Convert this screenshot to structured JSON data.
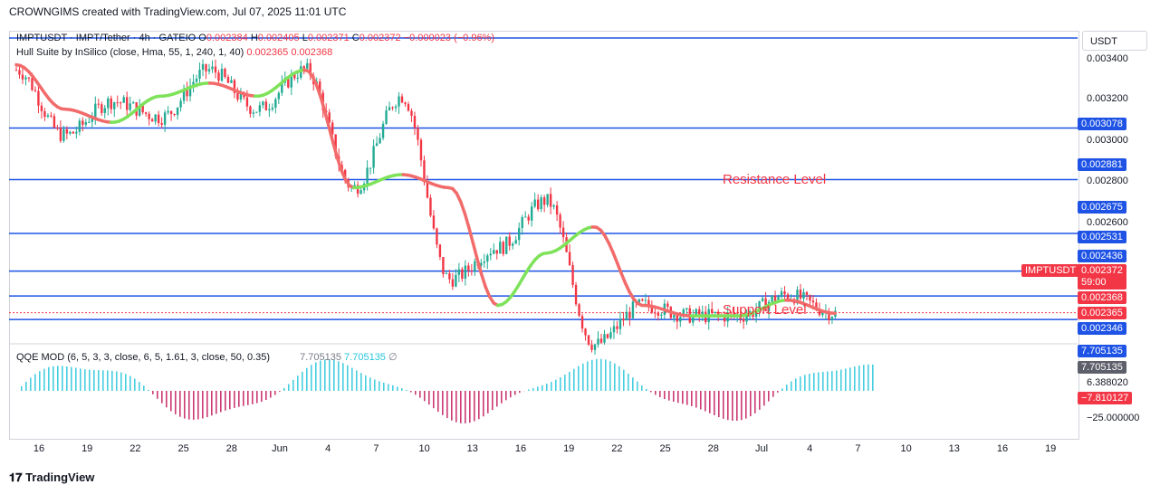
{
  "header": "CROWNGIMS created with TradingView.com, Jul 07, 2025 11:01 UTC",
  "legend": {
    "symbol": "IMPTUSDT · IMPT/Tether · 4h · GATEIO",
    "o_label": "O",
    "o": "0.002384",
    "h_label": "H",
    "h": "0.002405",
    "l_label": "L",
    "l": "0.002371",
    "c_label": "C",
    "c": "0.002372",
    "change": "−0.000023 (−0.96%)",
    "hull_name": "Hull Suite by InSilico (close, Hma, 55, 1, 240, 1, 40)",
    "hull_v1": "0.002365",
    "hull_v2": "0.002368",
    "qqe_name": "QQE MOD (6, 5, 3, 3, close, 6, 5, 1.61, 3, close, 50, 0.35)",
    "qqe_v1": "7.705135",
    "qqe_v2": "7.705135",
    "qqe_v3": "∅"
  },
  "annotations": {
    "resistance": "Resistance Level",
    "support": "Support Level"
  },
  "currency": "USDT",
  "price_axis": {
    "ticks": [
      "0.003400",
      "0.003200",
      "0.003000",
      "0.002800",
      "0.002600"
    ],
    "badges": [
      {
        "text": "0.003078",
        "color": "#1e53e5"
      },
      {
        "text": "0.002881",
        "color": "#1e53e5"
      },
      {
        "text": "0.002675",
        "color": "#1e53e5"
      },
      {
        "text": "0.002531",
        "color": "#1e53e5"
      },
      {
        "text": "0.002436",
        "color": "#1e53e5"
      },
      {
        "text": "0.002368",
        "color": "#f23645"
      },
      {
        "text": "0.002365",
        "color": "#f23645"
      },
      {
        "text": "0.002346",
        "color": "#1e53e5"
      }
    ],
    "last_symbol": "IMPTUSDT",
    "last_price": "0.002372",
    "countdown": "59:00"
  },
  "qqe_axis": {
    "ticks": [
      "6.388020",
      "−25.000000"
    ],
    "badges": [
      {
        "text": "7.705135",
        "color": "#1e53e5"
      },
      {
        "text": "7.705135",
        "color": "#5d606b"
      },
      {
        "text": "−7.810127",
        "color": "#f23645"
      }
    ]
  },
  "x_axis": [
    "16",
    "19",
    "22",
    "25",
    "28",
    "Jun",
    "4",
    "7",
    "10",
    "13",
    "16",
    "19",
    "22",
    "25",
    "28",
    "Jul",
    "4",
    "7",
    "10",
    "13",
    "16",
    "19"
  ],
  "footer": "TradingView",
  "chart_data": {
    "type": "line",
    "title": "IMPTUSDT · IMPT/Tether · 4h · GATEIO",
    "levels": [
      0.003078,
      0.002881,
      0.002675,
      0.002531,
      0.002436,
      0.002346
    ],
    "ylim": [
      0.00226,
      0.00345
    ],
    "x": [
      "16",
      "19",
      "22",
      "25",
      "28",
      "Jun",
      "4",
      "7",
      "10",
      "13",
      "16",
      "19",
      "22",
      "25",
      "28",
      "Jul",
      "4",
      "7"
    ],
    "series": [
      {
        "name": "IMPTUSDT",
        "values": [
          0.0033,
          0.00305,
          0.00318,
          0.00312,
          0.0033,
          0.00315,
          0.0033,
          0.00285,
          0.0032,
          0.0025,
          0.00262,
          0.0028,
          0.00225,
          0.0024,
          0.00236,
          0.00236,
          0.00244,
          0.00237
        ]
      },
      {
        "name": "Hull Suite",
        "values": [
          0.00332,
          0.00315,
          0.0031,
          0.0032,
          0.00325,
          0.0032,
          0.0033,
          0.00285,
          0.0029,
          0.00285,
          0.0024,
          0.0026,
          0.0027,
          0.0024,
          0.00236,
          0.00236,
          0.00242,
          0.00237
        ]
      }
    ]
  }
}
